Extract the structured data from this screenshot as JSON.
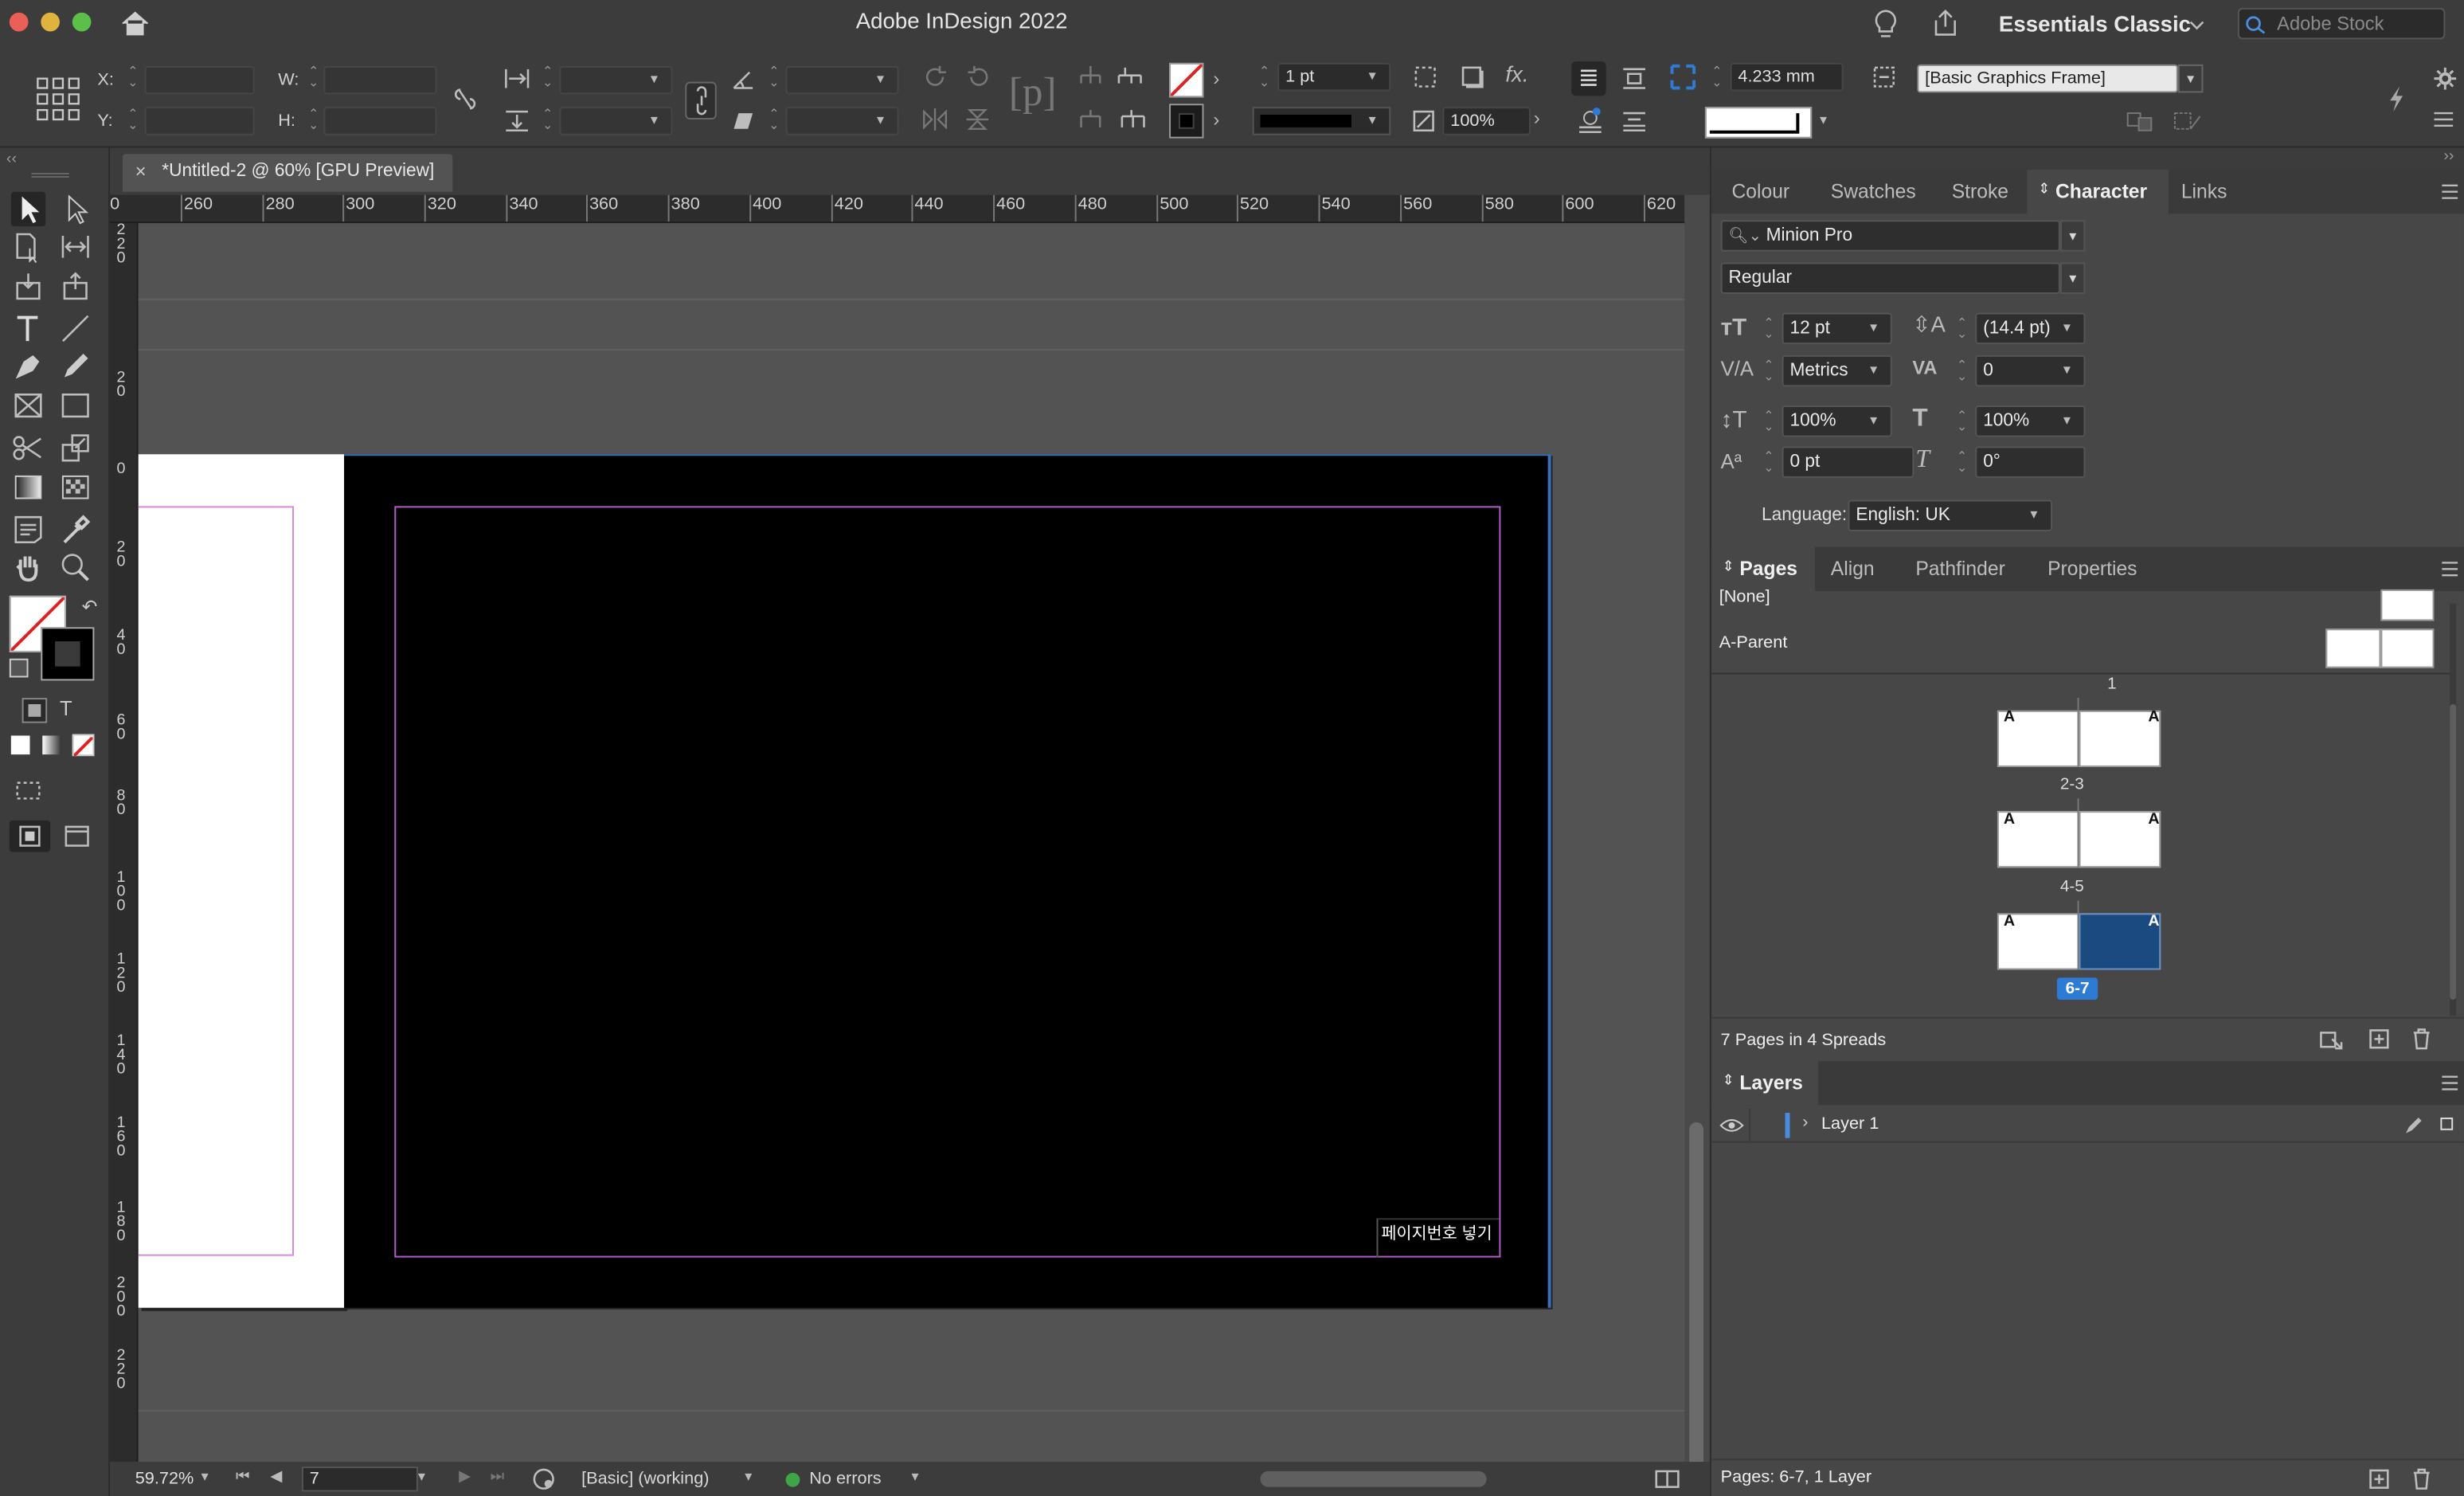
{
  "app": {
    "title": "Adobe InDesign 2022",
    "workspace": "Essentials Classic",
    "stock_search_placeholder": "Adobe Stock"
  },
  "control_bar": {
    "x_label": "X:",
    "y_label": "Y:",
    "w_label": "W:",
    "h_label": "H:",
    "stroke_weight": "1 pt",
    "opacity": "100%",
    "dimension": "4.233 mm",
    "object_style": "[Basic Graphics Frame]"
  },
  "document": {
    "tab_label": "*Untitled-2 @ 60% [GPU Preview]",
    "page_footer_text": "페이지번호 넣기"
  },
  "rulers": {
    "horizontal": [
      "0",
      "260",
      "280",
      "300",
      "320",
      "340",
      "360",
      "380",
      "400",
      "420",
      "440",
      "460",
      "480",
      "500",
      "520",
      "540",
      "560",
      "580",
      "600",
      "620"
    ],
    "vertical": [
      "220",
      "20",
      "0",
      "20",
      "40",
      "60",
      "80",
      "100",
      "120",
      "140",
      "160",
      "180",
      "200",
      "220"
    ]
  },
  "status_bar": {
    "zoom": "59.72%",
    "page": "7",
    "preflight_profile": "[Basic] (working)",
    "errors": "No errors"
  },
  "panels": {
    "top_tabs": [
      "Colour",
      "Swatches",
      "Stroke",
      "Character",
      "Links"
    ],
    "active_top_tab": "Character",
    "character": {
      "font_family": "Minion Pro",
      "font_style": "Regular",
      "font_size": "12 pt",
      "leading": "(14.4 pt)",
      "kerning": "Metrics",
      "tracking": "0",
      "vertical_scale": "100%",
      "horizontal_scale": "100%",
      "baseline_shift": "0 pt",
      "skew": "0°",
      "language_label": "Language:",
      "language": "English: UK"
    },
    "mid_tabs": [
      "Pages",
      "Align",
      "Pathfinder",
      "Properties"
    ],
    "pages": {
      "none_label": "[None]",
      "parent_label": "A-Parent",
      "spread_labels": [
        "1",
        "2-3",
        "4-5",
        "6-7"
      ],
      "parent_letter": "A",
      "summary": "7 Pages in 4 Spreads"
    },
    "layers": {
      "title": "Layers",
      "layer_name": "Layer 1",
      "footer": "Pages: 6-7, 1 Layer"
    }
  },
  "colors": {
    "selection_blue": "#1a4a80",
    "margin_guide": "#b45dc9",
    "accent_blue": "#2e7bd6",
    "status_ok": "#3fa648"
  }
}
